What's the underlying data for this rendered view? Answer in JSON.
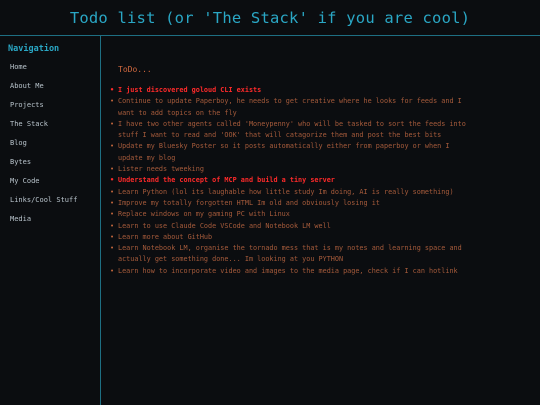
{
  "header": {
    "title": "Todo list (or 'The Stack' if you are cool)"
  },
  "sidebar": {
    "title": "Navigation",
    "items": [
      {
        "label": "Home"
      },
      {
        "label": "About Me"
      },
      {
        "label": "Projects"
      },
      {
        "label": "The Stack"
      },
      {
        "label": "Blog"
      },
      {
        "label": "Bytes"
      },
      {
        "label": "My Code"
      },
      {
        "label": "Links/Cool Stuff"
      },
      {
        "label": "Media"
      }
    ]
  },
  "main": {
    "heading": "ToDo...",
    "todos": [
      {
        "text": "I just discovered goloud CLI exists",
        "highlight": true
      },
      {
        "text": "Continue to update Paperboy, he needs to get creative where he looks for feeds and I want to add topics on the fly",
        "highlight": false
      },
      {
        "text": "I have two other agents called 'Moneypenny' who will be tasked to sort the feeds into stuff I want to read and 'OOK' that will catagorize them and post the best bits",
        "highlight": false
      },
      {
        "text": "Update my Bluesky Poster so it posts automatically either from paperboy or when I update my blog",
        "highlight": false
      },
      {
        "text": "Lister needs tweeking",
        "highlight": false
      },
      {
        "text": "Understand the concept of MCP and build a tiny server",
        "highlight": true
      },
      {
        "text": "Learn Python (lol its laughable how little study Im doing, AI is really something)",
        "highlight": false
      },
      {
        "text": "Improve my totally forgotten HTML Im old and obviously losing it",
        "highlight": false
      },
      {
        "text": "Replace windows on my gaming PC with Linux",
        "highlight": false
      },
      {
        "text": "Learn to use Claude Code VSCode and Notebook LM well",
        "highlight": false
      },
      {
        "text": "Learn more about GitHub",
        "highlight": false
      },
      {
        "text": "Learn Notebook LM, organise the tornado mess that is my notes and learning space and actually get something done... Im looking at you PYTHON",
        "highlight": false
      },
      {
        "text": "Learn how to incorporate video and images to the media page, check if I can hotlink",
        "highlight": false
      }
    ]
  },
  "colors": {
    "accent": "#2aa7c5",
    "todo_text": "#a65b3b",
    "todo_highlight": "#ff2a2a",
    "heading": "#d0683f",
    "background": "#0b0d10"
  }
}
